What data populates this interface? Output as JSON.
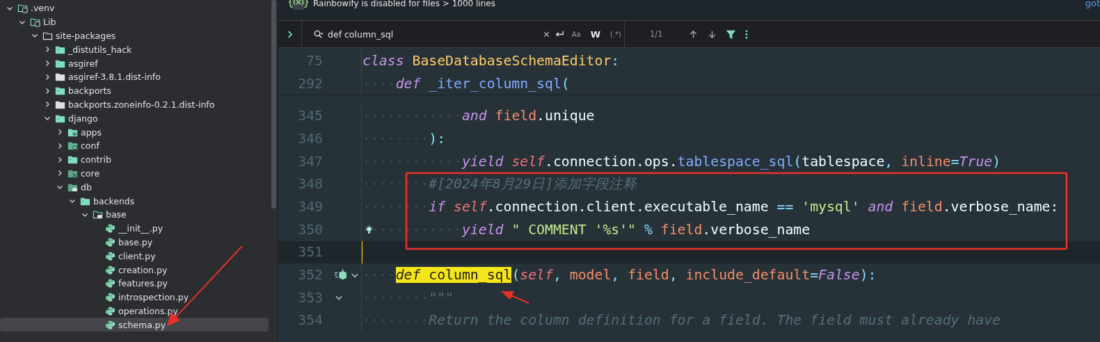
{
  "sidebar": {
    "tree": [
      {
        "name": ".venv",
        "kind": "venv",
        "expanded": true,
        "selected": false,
        "children": [
          {
            "name": "Lib",
            "kind": "library",
            "expanded": true,
            "selected": false,
            "children": [
              {
                "name": "site-packages",
                "kind": "outline",
                "expanded": true,
                "selected": false,
                "children": [
                  {
                    "name": "_distutils_hack",
                    "kind": "package",
                    "expanded": false,
                    "selected": false
                  },
                  {
                    "name": "asgiref",
                    "kind": "package",
                    "expanded": false,
                    "selected": false
                  },
                  {
                    "name": "asgiref-3.8.1.dist-info",
                    "kind": "plain",
                    "expanded": false,
                    "selected": false
                  },
                  {
                    "name": "backports",
                    "kind": "package",
                    "expanded": false,
                    "selected": false
                  },
                  {
                    "name": "backports.zoneinfo-0.2.1.dist-info",
                    "kind": "plain",
                    "expanded": false,
                    "selected": false
                  },
                  {
                    "name": "django",
                    "kind": "package",
                    "expanded": true,
                    "selected": false,
                    "children": [
                      {
                        "name": "apps",
                        "kind": "apps",
                        "expanded": false,
                        "selected": false
                      },
                      {
                        "name": "conf",
                        "kind": "conf",
                        "expanded": false,
                        "selected": false
                      },
                      {
                        "name": "contrib",
                        "kind": "package",
                        "expanded": false,
                        "selected": false
                      },
                      {
                        "name": "core",
                        "kind": "core",
                        "expanded": false,
                        "selected": false
                      },
                      {
                        "name": "db",
                        "kind": "db",
                        "expanded": true,
                        "selected": false,
                        "children": [
                          {
                            "name": "backends",
                            "kind": "package",
                            "expanded": true,
                            "selected": false,
                            "children": [
                              {
                                "name": "base",
                                "kind": "base",
                                "expanded": true,
                                "selected": false,
                                "children": [
                                  {
                                    "name": "__init__.py",
                                    "kind": "python",
                                    "selected": false
                                  },
                                  {
                                    "name": "base.py",
                                    "kind": "python",
                                    "selected": false
                                  },
                                  {
                                    "name": "client.py",
                                    "kind": "python",
                                    "selected": false
                                  },
                                  {
                                    "name": "creation.py",
                                    "kind": "python",
                                    "selected": false
                                  },
                                  {
                                    "name": "features.py",
                                    "kind": "python",
                                    "selected": false
                                  },
                                  {
                                    "name": "introspection.py",
                                    "kind": "python",
                                    "selected": false
                                  },
                                  {
                                    "name": "operations.py",
                                    "kind": "python",
                                    "selected": false
                                  },
                                  {
                                    "name": "schema.py",
                                    "kind": "python",
                                    "selected": true
                                  }
                                ]
                              }
                            ]
                          }
                        ]
                      }
                    ]
                  }
                ]
              }
            ]
          }
        ]
      }
    ]
  },
  "banner": {
    "message": "Rainbowify is disabled for files > 1000 lines",
    "link": "got"
  },
  "find_bar": {
    "query": "def column_sql",
    "options": [
      {
        "label": "Aa",
        "selected": false
      },
      {
        "label": "W",
        "selected": true
      },
      {
        "label": "(.*)",
        "selected": false
      }
    ],
    "match_count": "1/1",
    "filter_on": true
  },
  "editor": {
    "sticky_lines": [
      {
        "number": "75",
        "tokens": [
          {
            "text": "class ",
            "kind": "keyword"
          },
          {
            "text": "BaseDatabaseSchemaEditor",
            "kind": "class-name"
          },
          {
            "text": ":",
            "kind": "punct"
          }
        ]
      },
      {
        "number": "292",
        "tokens": [
          {
            "text": "    def ",
            "kind": "keyword"
          },
          {
            "text": "_iter_column_sql",
            "kind": "function"
          },
          {
            "text": "(",
            "kind": "punct"
          }
        ]
      }
    ],
    "lines": [
      {
        "number": "345",
        "kind": "plain",
        "current": false,
        "foldable": false,
        "tokens": [
          {
            "text": "            and ",
            "kind": "keyword"
          },
          {
            "text": "field",
            "kind": "param"
          },
          {
            "text": ".unique",
            "kind": "plain"
          }
        ]
      },
      {
        "number": "346",
        "kind": "plain",
        "current": false,
        "foldable": false,
        "tokens": [
          {
            "text": "        ):",
            "kind": "punct"
          }
        ]
      },
      {
        "number": "347",
        "kind": "plain",
        "current": false,
        "foldable": false,
        "tokens": [
          {
            "text": "            yield ",
            "kind": "keyword"
          },
          {
            "text": "self",
            "kind": "self"
          },
          {
            "text": ".connection.ops.",
            "kind": "plain"
          },
          {
            "text": "tablespace_sql",
            "kind": "method"
          },
          {
            "text": "(",
            "kind": "punct"
          },
          {
            "text": "tablespace",
            "kind": "plain"
          },
          {
            "text": ", ",
            "kind": "punct"
          },
          {
            "text": "inline",
            "kind": "param"
          },
          {
            "text": "=",
            "kind": "operator"
          },
          {
            "text": "True",
            "kind": "constant"
          },
          {
            "text": ")",
            "kind": "punct"
          }
        ]
      },
      {
        "number": "348",
        "kind": "plain",
        "current": false,
        "foldable": false,
        "tokens": [
          {
            "text": "        #[2024年8月29日]添加字段注释",
            "kind": "comment"
          }
        ]
      },
      {
        "number": "349",
        "kind": "plain",
        "current": false,
        "foldable": false,
        "tokens": [
          {
            "text": "        if ",
            "kind": "keyword"
          },
          {
            "text": "self",
            "kind": "self"
          },
          {
            "text": ".connection.client.executable_name",
            "kind": "plain"
          },
          {
            "text": " == ",
            "kind": "operator"
          },
          {
            "text": "'mysql' ",
            "kind": "string"
          },
          {
            "text": "and ",
            "kind": "keyword"
          },
          {
            "text": "field",
            "kind": "param"
          },
          {
            "text": ".verbose_name:",
            "kind": "plain"
          }
        ]
      },
      {
        "number": "350",
        "kind": "bulb",
        "current": false,
        "foldable": false,
        "tokens": [
          {
            "text": "            yield ",
            "kind": "keyword"
          },
          {
            "text": "\" COMMENT '%s'\"",
            "kind": "string"
          },
          {
            "text": " % ",
            "kind": "operator"
          },
          {
            "text": "field",
            "kind": "param"
          },
          {
            "text": ".verbose_name",
            "kind": "plain"
          }
        ]
      },
      {
        "number": "351",
        "kind": "plain",
        "current": true,
        "foldable": false
      },
      {
        "number": "352",
        "kind": "override",
        "current": false,
        "foldable": true,
        "tokens": [
          {
            "text": "    def ",
            "kind": "keyword",
            "match": true
          },
          {
            "text": "column_sql",
            "kind": "plain",
            "match": true
          },
          {
            "text": "(",
            "kind": "punct",
            "match": false
          },
          {
            "text": "self",
            "kind": "self",
            "match": false
          },
          {
            "text": ", ",
            "kind": "punct",
            "match": false
          },
          {
            "text": "model",
            "kind": "param",
            "match": false
          },
          {
            "text": ", ",
            "kind": "punct",
            "match": false
          },
          {
            "text": "field",
            "kind": "param",
            "match": false
          },
          {
            "text": ", ",
            "kind": "punct",
            "match": false
          },
          {
            "text": "include_default",
            "kind": "param",
            "match": false
          },
          {
            "text": "=",
            "kind": "operator",
            "match": false
          },
          {
            "text": "False",
            "kind": "constant",
            "match": false
          },
          {
            "text": "):",
            "kind": "punct",
            "match": false
          }
        ]
      },
      {
        "number": "353",
        "kind": "plain",
        "current": false,
        "foldable": true,
        "tokens": [
          {
            "text": "        \"\"\"",
            "kind": "docstring"
          }
        ]
      },
      {
        "number": "354",
        "kind": "plain",
        "current": false,
        "foldable": false,
        "tokens": [
          {
            "text": "        Return the column definition for a field. The field must already have",
            "kind": "docstring"
          }
        ]
      }
    ]
  }
}
